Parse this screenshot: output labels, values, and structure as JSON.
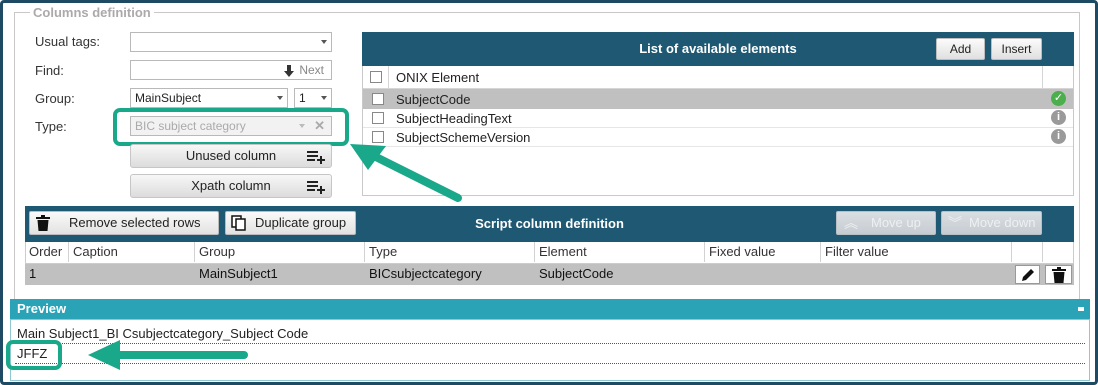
{
  "fieldset": {
    "legend": "Columns definition"
  },
  "form": {
    "usual_tags_label": "Usual tags:",
    "usual_tags_value": "",
    "find_label": "Find:",
    "find_value": "",
    "next_label": "Next",
    "group_label": "Group:",
    "group_value": "MainSubject",
    "group_index": "1",
    "type_label": "Type:",
    "type_value": "BIC subject category",
    "unused_column_label": "Unused column",
    "xpath_column_label": "Xpath column"
  },
  "elements_panel": {
    "title": "List of available elements",
    "add_label": "Add",
    "insert_label": "Insert",
    "column_header": "ONIX Element",
    "rows": [
      {
        "name": "SubjectCode",
        "status": "ok"
      },
      {
        "name": "SubjectHeadingText",
        "status": "info"
      },
      {
        "name": "SubjectSchemeVersion",
        "status": "info"
      }
    ]
  },
  "script_panel": {
    "title": "Script column definition",
    "remove_label": "Remove selected rows",
    "duplicate_label": "Duplicate group",
    "move_up_label": "Move up",
    "move_down_label": "Move down",
    "headers": [
      "Order",
      "Caption",
      "Group",
      "Type",
      "Element",
      "Fixed value",
      "Filter value"
    ],
    "rows": [
      {
        "order": "1",
        "caption": "",
        "group": "MainSubject1",
        "type": "BICsubjectcategory",
        "element": "SubjectCode",
        "fixed": "",
        "filter": ""
      }
    ]
  },
  "preview": {
    "title": "Preview",
    "header_line": "Main Subject1_BI Csubjectcategory_Subject Code",
    "value_line": "JFFZ"
  },
  "colors": {
    "panel_header": "#1f5873",
    "preview_header": "#2aa3b7",
    "highlight": "#1aa88a",
    "selected_row": "#c0c0c0"
  }
}
